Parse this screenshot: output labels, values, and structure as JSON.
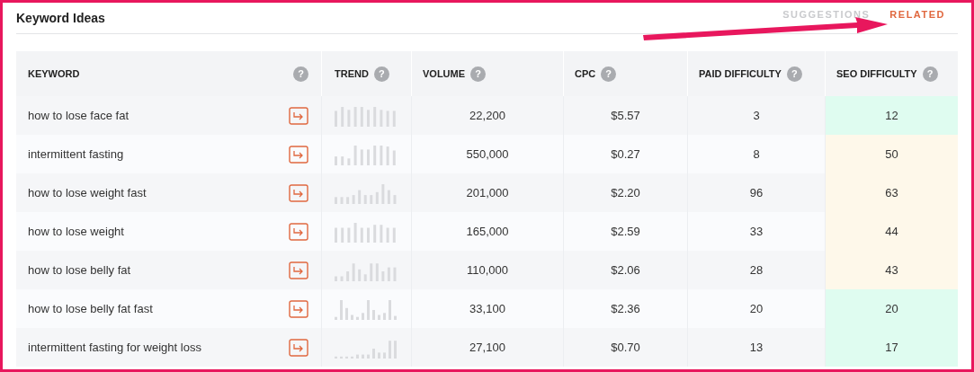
{
  "title": "Keyword Ideas",
  "tabs": [
    {
      "label": "SUGGESTIONS",
      "selected": false
    },
    {
      "label": "RELATED",
      "selected": true
    }
  ],
  "help_mark": "?",
  "columns": [
    "KEYWORD",
    "TREND",
    "VOLUME",
    "CPC",
    "PAID DIFFICULTY",
    "SEO DIFFICULTY"
  ],
  "rows": [
    {
      "keyword": "how to lose face fat",
      "volume": "22,200",
      "cpc": "$5.57",
      "paid_difficulty": "3",
      "seo_difficulty": "12",
      "color": "#dffcf0"
    },
    {
      "keyword": "intermittent fasting",
      "volume": "550,000",
      "cpc": "$0.27",
      "paid_difficulty": "8",
      "seo_difficulty": "50",
      "color": "#fef8ea"
    },
    {
      "keyword": "how to lose weight fast",
      "volume": "201,000",
      "cpc": "$2.20",
      "paid_difficulty": "96",
      "seo_difficulty": "63",
      "color": "#fef8ea"
    },
    {
      "keyword": "how to lose weight",
      "volume": "165,000",
      "cpc": "$2.59",
      "paid_difficulty": "33",
      "seo_difficulty": "44",
      "color": "#fef8ea"
    },
    {
      "keyword": "how to lose belly fat",
      "volume": "110,000",
      "cpc": "$2.06",
      "paid_difficulty": "28",
      "seo_difficulty": "43",
      "color": "#fef8ea"
    },
    {
      "keyword": "how to lose belly fat fast",
      "volume": "33,100",
      "cpc": "$2.36",
      "paid_difficulty": "20",
      "seo_difficulty": "20",
      "color": "#dffcf0"
    },
    {
      "keyword": "intermittent fasting for weight loss",
      "volume": "27,100",
      "cpc": "$0.70",
      "paid_difficulty": "13",
      "seo_difficulty": "17",
      "color": "#dffcf0"
    }
  ]
}
